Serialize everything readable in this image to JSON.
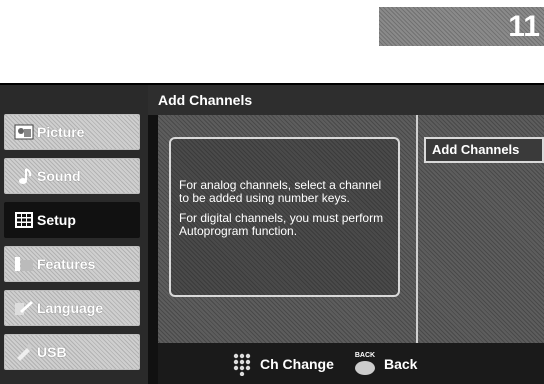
{
  "page_number": "11",
  "sidebar": {
    "items": [
      {
        "label": "Picture",
        "icon": "picture-icon",
        "active": false
      },
      {
        "label": "Sound",
        "icon": "sound-icon",
        "active": false
      },
      {
        "label": "Setup",
        "icon": "setup-icon",
        "active": true
      },
      {
        "label": "Features",
        "icon": "features-icon",
        "active": false
      },
      {
        "label": "Language",
        "icon": "language-icon",
        "active": false
      },
      {
        "label": "USB",
        "icon": "usb-icon",
        "active": false
      }
    ]
  },
  "header": {
    "title": "Add Channels"
  },
  "message": {
    "line1": "For analog channels, select a channel to be added using number keys.",
    "line2": "For digital channels, you must perform Autoprogram function."
  },
  "option": {
    "label": "Add Channels"
  },
  "footer": {
    "ch_change": {
      "label": "Ch Change",
      "icon": "keypad-icon"
    },
    "back": {
      "label": "Back",
      "icon_text": "BACK",
      "icon": "back-button-icon"
    }
  }
}
